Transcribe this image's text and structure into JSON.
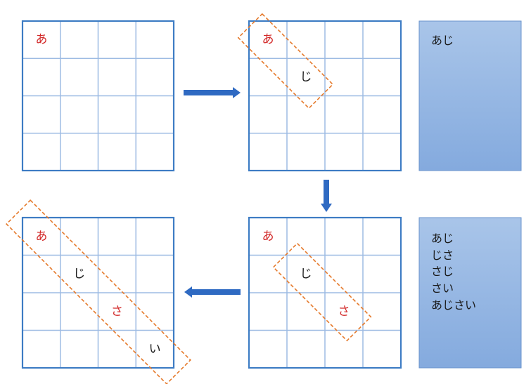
{
  "colors": {
    "grid_outer": "#3d7cc4",
    "grid_inner": "#9dbbe3",
    "red_char": "#d22828",
    "black_char": "#1a1a1a",
    "dash": "#e57a2c",
    "arrow": "#2f6ac2",
    "panel_top": "#a9c5e9",
    "panel_bottom": "#84aade",
    "panel_border": "#6a93cc"
  },
  "grids": [
    {
      "id": "top-left",
      "cells": [
        {
          "row": 0,
          "col": 0,
          "char": "あ",
          "color": "red"
        }
      ]
    },
    {
      "id": "top-right",
      "cells": [
        {
          "row": 0,
          "col": 0,
          "char": "あ",
          "color": "red"
        },
        {
          "row": 1,
          "col": 1,
          "char": "じ",
          "color": "black"
        }
      ]
    },
    {
      "id": "bottom-right",
      "cells": [
        {
          "row": 0,
          "col": 0,
          "char": "あ",
          "color": "red"
        },
        {
          "row": 1,
          "col": 1,
          "char": "じ",
          "color": "black"
        },
        {
          "row": 2,
          "col": 2,
          "char": "さ",
          "color": "red"
        }
      ]
    },
    {
      "id": "bottom-left",
      "cells": [
        {
          "row": 0,
          "col": 0,
          "char": "あ",
          "color": "red"
        },
        {
          "row": 1,
          "col": 1,
          "char": "じ",
          "color": "black"
        },
        {
          "row": 2,
          "col": 2,
          "char": "さ",
          "color": "red"
        },
        {
          "row": 3,
          "col": 3,
          "char": "い",
          "color": "black"
        }
      ]
    }
  ],
  "word_panels": [
    {
      "id": "top",
      "words": [
        "あじ"
      ]
    },
    {
      "id": "bottom",
      "words": [
        "あじ",
        "じさ",
        "さじ",
        "さい",
        "あじさい"
      ]
    }
  ],
  "arrows": [
    "right",
    "down",
    "left"
  ]
}
